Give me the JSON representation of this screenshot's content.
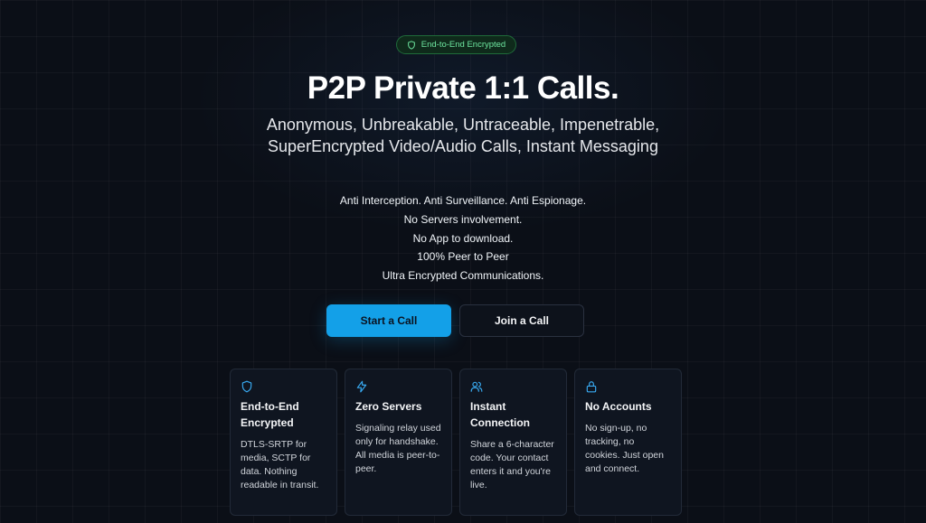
{
  "badge": {
    "icon": "shield-icon",
    "label": "End-to-End Encrypted",
    "color": "#6ee7a0"
  },
  "hero": {
    "title": "P2P Private 1:1 Calls.",
    "subtitle": "Anonymous, Unbreakable, Untraceable, Impenetrable, SuperEncrypted Video/Audio Calls, Instant Messaging",
    "lines": [
      "Anti Interception. Anti Surveillance. Anti Espionage.",
      "No Servers involvement.",
      "No App to download.",
      "100% Peer to Peer",
      "Ultra Encrypted Communications."
    ]
  },
  "actions": {
    "start_label": "Start a Call",
    "join_label": "Join a Call",
    "accent": "#13a0e8"
  },
  "features": [
    {
      "icon": "shield-icon",
      "title": "End-to-End Encrypted",
      "desc": "DTLS-SRTP for media, SCTP for data. Nothing readable in transit."
    },
    {
      "icon": "lightning-icon",
      "title": "Zero Servers",
      "desc": "Signaling relay used only for handshake. All media is peer-to-peer."
    },
    {
      "icon": "users-icon",
      "title": "Instant Connection",
      "desc": "Share a 6-character code. Your contact enters it and you're live."
    },
    {
      "icon": "lock-icon",
      "title": "No Accounts",
      "desc": "No sign-up, no tracking, no cookies. Just open and connect."
    }
  ]
}
